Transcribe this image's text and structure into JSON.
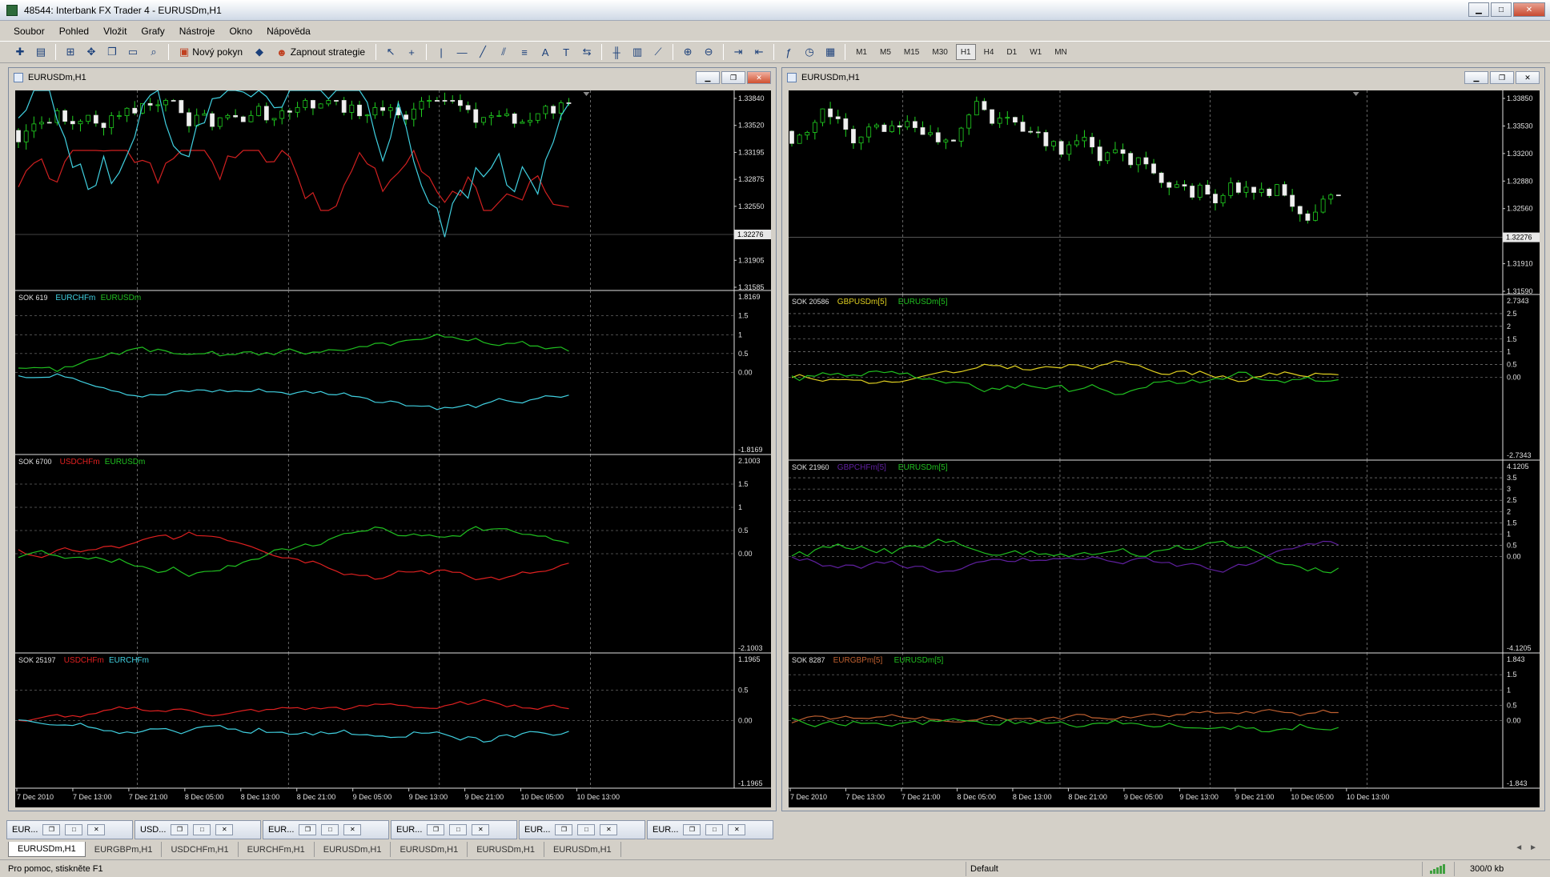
{
  "window": {
    "title": "48544: Interbank FX Trader 4 - EURUSDm,H1"
  },
  "menu": [
    "Soubor",
    "Pohled",
    "Vložit",
    "Grafy",
    "Nástroje",
    "Okno",
    "Nápověda"
  ],
  "toolbar": {
    "new_order": "Nový pokyn",
    "strategies": "Zapnout strategie",
    "timeframes": [
      "M1",
      "M5",
      "M15",
      "M30",
      "H1",
      "H4",
      "D1",
      "W1",
      "MN"
    ],
    "active_tf": "H1"
  },
  "charts": [
    {
      "title": "EURUSDm,H1",
      "price_labels": [
        "1.33840",
        "1.33520",
        "1.33195",
        "1.32875",
        "1.32550",
        "1.32276",
        "1.31905",
        "1.31585"
      ],
      "current_price": "1.32276",
      "time_labels": [
        "7 Dec 2010",
        "7 Dec 13:00",
        "7 Dec 21:00",
        "8 Dec 05:00",
        "8 Dec 13:00",
        "8 Dec 21:00",
        "9 Dec 05:00",
        "9 Dec 13:00",
        "9 Dec 21:00",
        "10 Dec 05:00",
        "10 Dec 13:00"
      ],
      "panels": [
        {
          "sok": "SOK 619",
          "legend": [
            {
              "name": "EURCHFm",
              "color": "#40d0e0"
            },
            {
              "name": "EURUSDm",
              "color": "#20c020"
            }
          ],
          "scale": [
            "1.8169",
            "1.5",
            "1",
            "0.5",
            "0.00",
            "-1.8169"
          ]
        },
        {
          "sok": "SOK 6700",
          "legend": [
            {
              "name": "USDCHFm",
              "color": "#e02020"
            },
            {
              "name": "EURUSDm",
              "color": "#20c020"
            }
          ],
          "scale": [
            "2.1003",
            "1.5",
            "1",
            "0.5",
            "0.00",
            "-2.1003"
          ]
        },
        {
          "sok": "SOK 25197",
          "legend": [
            {
              "name": "USDCHFm",
              "color": "#e02020"
            },
            {
              "name": "EURCHFm",
              "color": "#40d0e0"
            }
          ],
          "scale": [
            "1.1965",
            "0.5",
            "0.00",
            "-1.1965"
          ]
        }
      ]
    },
    {
      "title": "EURUSDm,H1",
      "price_labels": [
        "1.33850",
        "1.33530",
        "1.33200",
        "1.32880",
        "1.32560",
        "1.32276",
        "1.31910",
        "1.31590"
      ],
      "current_price": "1.32276",
      "time_labels": [
        "7 Dec 2010",
        "7 Dec 13:00",
        "7 Dec 21:00",
        "8 Dec 05:00",
        "8 Dec 13:00",
        "8 Dec 21:00",
        "9 Dec 05:00",
        "9 Dec 13:00",
        "9 Dec 21:00",
        "10 Dec 05:00",
        "10 Dec 13:00"
      ],
      "panels": [
        {
          "sok": "SOK 20586",
          "legend": [
            {
              "name": "GBPUSDm[5]",
              "color": "#e0d020"
            },
            {
              "name": "EURUSDm[5]",
              "color": "#20c020"
            }
          ],
          "scale": [
            "2.7343",
            "2.5",
            "2",
            "1.5",
            "1",
            "0.5",
            "0.00",
            "-2.7343"
          ]
        },
        {
          "sok": "SOK 21960",
          "legend": [
            {
              "name": "GBPCHFm[5]",
              "color": "#6020a0"
            },
            {
              "name": "EURUSDm[5]",
              "color": "#20c020"
            }
          ],
          "scale": [
            "4.1205",
            "3.5",
            "3",
            "2.5",
            "2",
            "1.5",
            "1",
            "0.5",
            "0.00",
            "-4.1205"
          ]
        },
        {
          "sok": "SOK 8287",
          "legend": [
            {
              "name": "EURGBPm[5]",
              "color": "#c06030"
            },
            {
              "name": "EURUSDm[5]",
              "color": "#20c020"
            }
          ],
          "scale": [
            "1.843",
            "1.5",
            "1",
            "0.5",
            "0.00",
            "-1.843"
          ]
        }
      ]
    }
  ],
  "window_tabs": [
    "EUR...",
    "USD...",
    "EUR...",
    "EUR...",
    "EUR...",
    "EUR..."
  ],
  "chart_tabs": [
    "EURUSDm,H1",
    "EURGBPm,H1",
    "USDCHFm,H1",
    "EURCHFm,H1",
    "EURUSDm,H1",
    "EURUSDm,H1",
    "EURUSDm,H1",
    "EURUSDm,H1"
  ],
  "status": {
    "help": "Pro pomoc, stiskněte F1",
    "profile": "Default",
    "traffic": "300/0 kb"
  }
}
